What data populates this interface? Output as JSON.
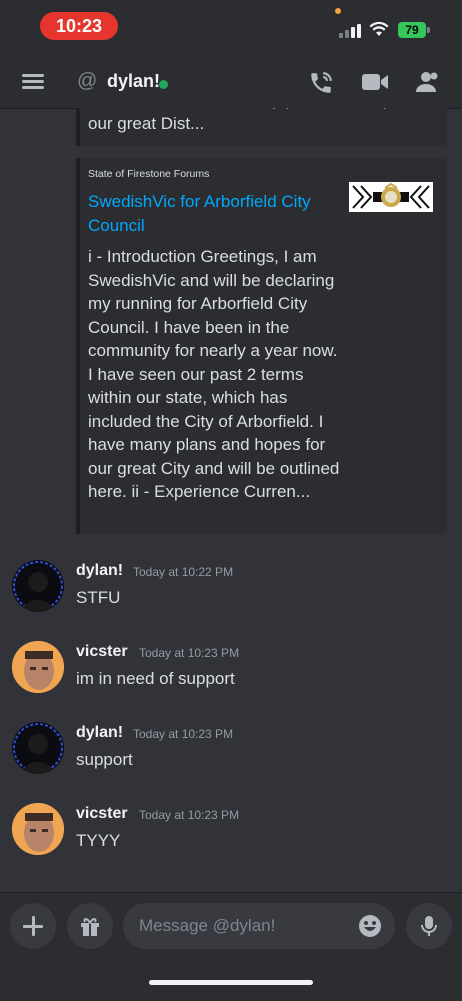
{
  "status_bar": {
    "time": "10:23",
    "battery": "79"
  },
  "header": {
    "title": "dylan!",
    "icons": [
      "menu-icon",
      "at-icon",
      "call-icon",
      "video-icon",
      "members-icon"
    ],
    "online_color": "#23a55a"
  },
  "embeds": {
    "previous_tail": "Prominence. I have many plans and hopes for our great Dist...",
    "current": {
      "provider": "State of Firestone Forums",
      "title": "SwedishVic for Arborfield City Council",
      "description": "i - Introduction  Greetings, I am SwedishVic and will be declaring my running for Arborfield City Council. I have been in the community for nearly a year now. I have seen our past 2 terms within our state, which has included the City of Arborfield. I have many plans and hopes for our great City and will be outlined here.  ii - Experience  Curren..."
    }
  },
  "messages": [
    {
      "author": "dylan!",
      "timestamp": "Today at 10:22 PM",
      "text": "STFU"
    },
    {
      "author": "vicster",
      "timestamp": "Today at 10:23 PM",
      "text": "im in need of support"
    },
    {
      "author": "dylan!",
      "timestamp": "Today at 10:23 PM",
      "text": "support"
    },
    {
      "author": "vicster",
      "timestamp": "Today at 10:23 PM",
      "text": "TYYY"
    }
  ],
  "composer": {
    "placeholder": "Message @dylan!",
    "icons": [
      "plus-icon",
      "gift-icon",
      "emoji-icon",
      "microphone-icon"
    ]
  },
  "colors": {
    "background": "#313338",
    "link": "#00a8fc",
    "status_pill": "#e5352c",
    "battery": "#35c759"
  }
}
